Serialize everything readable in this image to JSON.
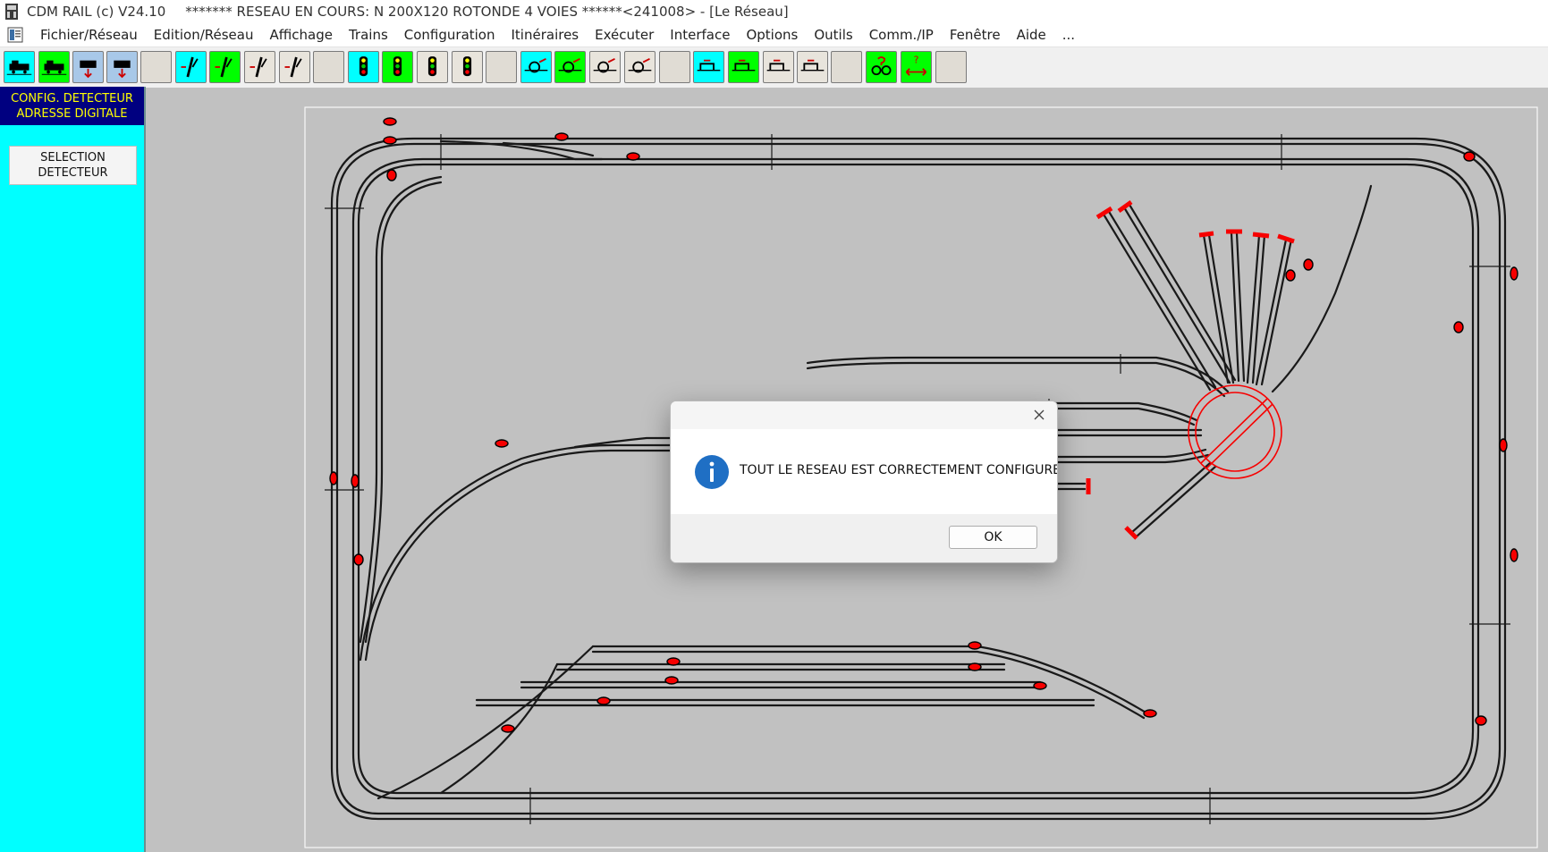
{
  "window": {
    "app": "CDM RAIL (c) V24.10",
    "title": "******* RESEAU EN COURS: N 200X120 ROTONDE 4 VOIES ******<241008> - [Le Réseau]"
  },
  "menu": [
    "Fichier/Réseau",
    "Edition/Réseau",
    "Affichage",
    "Trains",
    "Configuration",
    "Itinéraires",
    "Exécuter",
    "Interface",
    "Options",
    "Outils",
    "Comm./IP",
    "Fenêtre",
    "Aide",
    "..."
  ],
  "toolbar": {
    "buttons": [
      {
        "name": "locomotive-tool-icon",
        "bg": "#00ffff"
      },
      {
        "name": "train-tool-icon",
        "bg": "#00ff00"
      },
      {
        "name": "wagon-up-tool-icon",
        "bg": "#a8c8e8"
      },
      {
        "name": "wagon-down-tool-icon",
        "bg": "#a8c8e8"
      },
      {
        "name": "empty-slot",
        "bg": "#e0dcd4"
      },
      {
        "name": "turnout-tool-icon",
        "bg": "#00ffff"
      },
      {
        "name": "turnout-set-tool-icon",
        "bg": "#00ff00"
      },
      {
        "name": "turnout-left-tool-icon",
        "bg": "#e8e4dc"
      },
      {
        "name": "turnout-right-tool-icon",
        "bg": "#e8e4dc"
      },
      {
        "name": "empty-slot",
        "bg": "#e0dcd4"
      },
      {
        "name": "signal-tool-icon",
        "bg": "#00ffff"
      },
      {
        "name": "signal-set-tool-icon",
        "bg": "#00ff00"
      },
      {
        "name": "signal-left-tool-icon",
        "bg": "#e8e4dc"
      },
      {
        "name": "signal-right-tool-icon",
        "bg": "#e8e4dc"
      },
      {
        "name": "empty-slot",
        "bg": "#e0dcd4"
      },
      {
        "name": "detector-tool-icon",
        "bg": "#00ffff"
      },
      {
        "name": "detector-set-tool-icon",
        "bg": "#00ff00"
      },
      {
        "name": "detector-left-tool-icon",
        "bg": "#e8e4dc"
      },
      {
        "name": "detector-right-tool-icon",
        "bg": "#e8e4dc"
      },
      {
        "name": "empty-slot",
        "bg": "#e0dcd4"
      },
      {
        "name": "block-tool-icon",
        "bg": "#00ffff"
      },
      {
        "name": "block-set-tool-icon",
        "bg": "#00ff00"
      },
      {
        "name": "block-left-tool-icon",
        "bg": "#e8e4dc"
      },
      {
        "name": "block-right-tool-icon",
        "bg": "#e8e4dc"
      },
      {
        "name": "empty-slot",
        "bg": "#e0dcd4"
      },
      {
        "name": "config-detector-tool-icon",
        "bg": "#00ff00"
      },
      {
        "name": "help-address-tool-icon",
        "bg": "#00ff00"
      },
      {
        "name": "empty-slot",
        "bg": "#e0dcd4"
      }
    ]
  },
  "sidebar": {
    "header": [
      "CONFIG. DETECTEUR",
      "ADRESSE DIGITALE"
    ],
    "button": [
      "SELECTION",
      "DETECTEUR"
    ]
  },
  "dialog": {
    "message": "TOUT LE RESEAU EST CORRECTEMENT CONFIGURE",
    "ok": "OK",
    "icon": "info-icon",
    "close_icon": "close-icon"
  },
  "colors": {
    "sidebar_bg": "#00ffff",
    "sidebar_header_bg": "#000080",
    "sidebar_header_text": "#ffff00",
    "layout_bg": "#c8c8c8",
    "track": "#1a1a1a",
    "signal": "#ff0000",
    "info_icon": "#1f6fc4"
  }
}
